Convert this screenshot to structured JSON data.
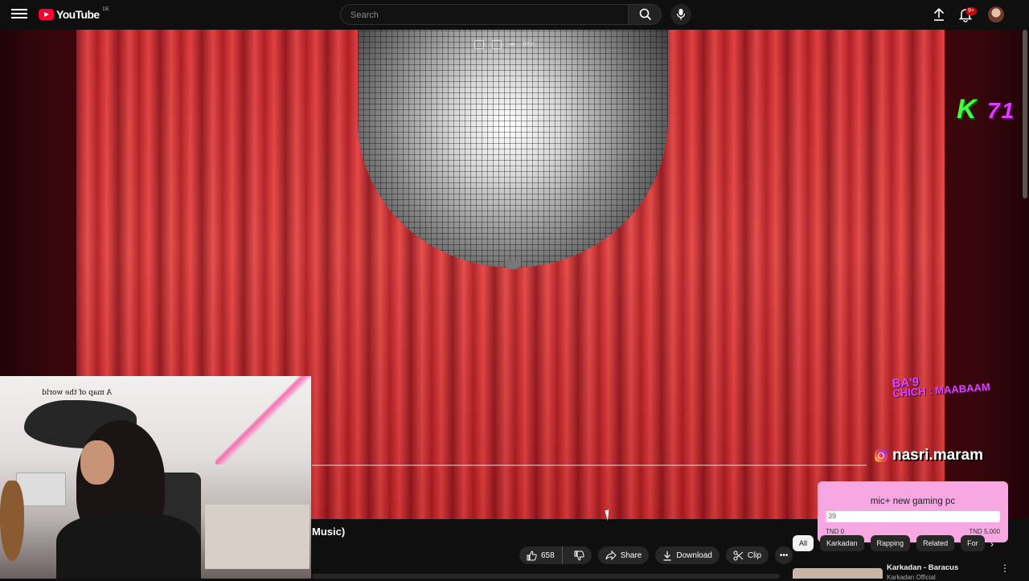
{
  "header": {
    "logo_text": "YouTube",
    "logo_region": "DE",
    "search_placeholder": "Search",
    "notification_count": "9+"
  },
  "player": {
    "controls_label": "REX",
    "overlay_k": "K",
    "overlay_number": "71",
    "overlay_bach_line1": "BA'9",
    "overlay_bach_line2": "CHICH : MAABAAM",
    "instagram_handle": "nasri.maram",
    "webcam_map_text": "A map of the world"
  },
  "goal": {
    "title": "mic+ new gaming pc",
    "current": "39",
    "fraction": 0.0078,
    "min_label": "TND 0",
    "max_label": "TND 5,000"
  },
  "video": {
    "title_fragment": "Music)",
    "like_count": "658",
    "share_label": "Share",
    "download_label": "Download",
    "clip_label": "Clip"
  },
  "chips": [
    {
      "label": "All"
    },
    {
      "label": "Karkadan"
    },
    {
      "label": "Rapping"
    },
    {
      "label": "Related"
    },
    {
      "label": "For"
    }
  ],
  "recommendation": {
    "title": "Karkadan - Baracus",
    "channel": "Karkadan Official"
  },
  "colors": {
    "accent": "#ff0033",
    "goal_bg": "#f7a8e3",
    "overlay_green": "#3fff3f",
    "overlay_pink": "#e03cff"
  }
}
